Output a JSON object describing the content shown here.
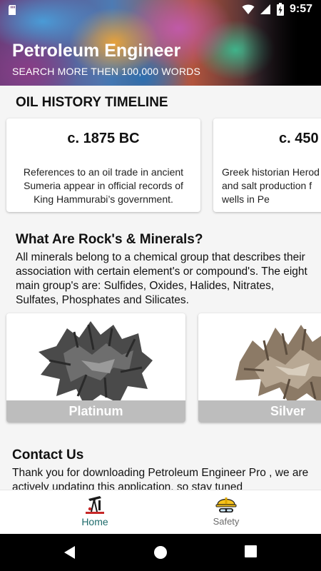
{
  "status_bar": {
    "time": "9:57"
  },
  "header": {
    "title": "Petroleum Engineer",
    "subtitle": "SEARCH MORE THEN 100,000 WORDS"
  },
  "timeline": {
    "title": "OIL HISTORY TIMELINE",
    "cards": [
      {
        "date": "c. 1875 BC",
        "description": "References to an oil trade in ancient Sumeria appear in official records of King Hammurabi’s government."
      },
      {
        "date": "c. 450",
        "description": "Greek historian Herod\nand salt production f\nwells in Pe"
      }
    ]
  },
  "rocks": {
    "title": "What Are Rock's & Minerals?",
    "body": "All minerals belong to a chemical group that describes their association with certain element's or compound's. The eight main group's are: Sulfides, Oxides, Halides, Nitrates, Sulfates, Phosphates and Silicates.",
    "minerals": [
      {
        "name": "Platinum"
      },
      {
        "name": "Silver"
      }
    ]
  },
  "contact": {
    "title": "Contact Us",
    "body": "Thank you for downloading Petroleum Engineer Pro , we are actively updating this application, so stay tuned"
  },
  "bottom_nav": {
    "items": [
      {
        "label": "Home",
        "icon": "oil-derrick-icon",
        "active": true
      },
      {
        "label": "Safety",
        "icon": "hard-hat-icon",
        "active": false
      }
    ]
  },
  "colors": {
    "active_nav": "#1e6b6b",
    "inactive_nav": "#6b6b6b",
    "label_bar": "#bdbdbd"
  }
}
